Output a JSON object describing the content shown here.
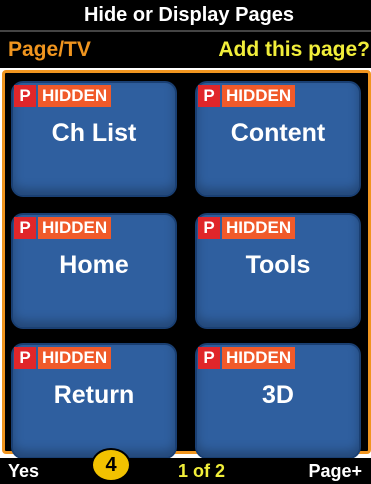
{
  "title": "Hide or Display Pages",
  "header": {
    "left": "Page/TV",
    "right": "Add this page?"
  },
  "tiles": [
    {
      "tag_p": "P",
      "tag_status": "HIDDEN",
      "label": "Ch List"
    },
    {
      "tag_p": "P",
      "tag_status": "HIDDEN",
      "label": "Content"
    },
    {
      "tag_p": "P",
      "tag_status": "HIDDEN",
      "label": "Home"
    },
    {
      "tag_p": "P",
      "tag_status": "HIDDEN",
      "label": "Tools"
    },
    {
      "tag_p": "P",
      "tag_status": "HIDDEN",
      "label": "Return"
    },
    {
      "tag_p": "P",
      "tag_status": "HIDDEN",
      "label": "3D"
    }
  ],
  "footer": {
    "yes": "Yes",
    "pagination": "1 of 2",
    "next": "Page+"
  },
  "badge": "4",
  "colors": {
    "accent_orange": "#f0951f",
    "accent_yellow": "#f1ee3a",
    "tile_blue": "#2f5f9f",
    "hidden_red": "#e0262a"
  }
}
